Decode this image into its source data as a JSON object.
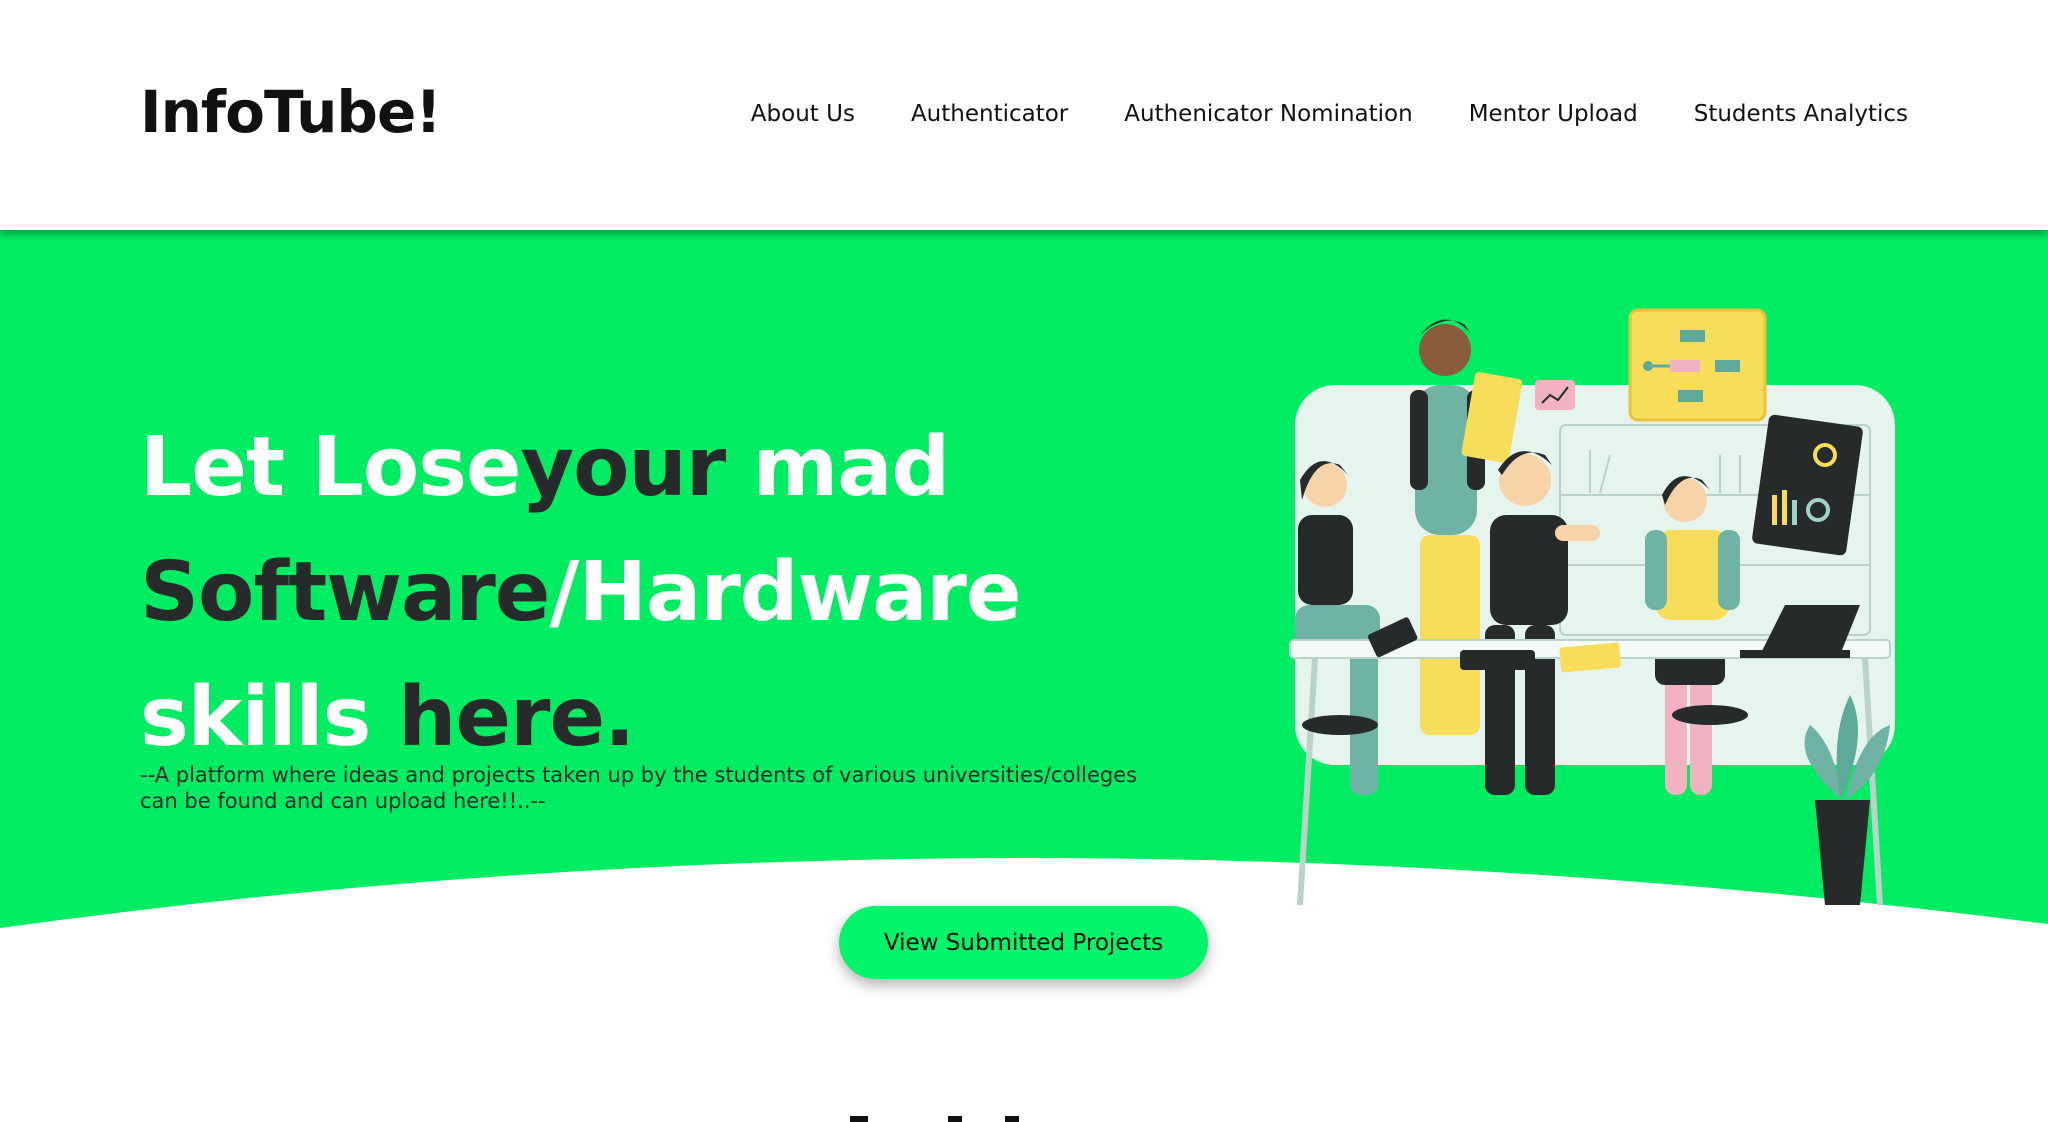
{
  "header": {
    "logo": "InfoTube!",
    "nav": [
      "About Us",
      "Authenticator",
      "Authenicator Nomination",
      "Mentor Upload",
      "Students Analytics"
    ]
  },
  "hero": {
    "title_parts": [
      {
        "text": "Let Lose",
        "color": "white"
      },
      {
        "text": "your",
        "color": "dark"
      },
      {
        "text": " mad",
        "color": "white"
      },
      {
        "text": "Software",
        "color": "dark"
      },
      {
        "text": "/Hardware",
        "color": "white"
      },
      {
        "text": "skills ",
        "color": "white"
      },
      {
        "text": "here.",
        "color": "dark"
      }
    ],
    "subtitle_line1": "--A platform where ideas and projects taken up by the students of various universities/colleges",
    "subtitle_line2": "can be found and can upload here!!..--",
    "cta_label": "View Submitted Projects",
    "illustration": "team-working-at-desk-illustration"
  },
  "colors": {
    "accent_green": "#00ed63",
    "button_green": "#00f56a",
    "dark_text": "#262a2a",
    "white": "#ffffff"
  }
}
